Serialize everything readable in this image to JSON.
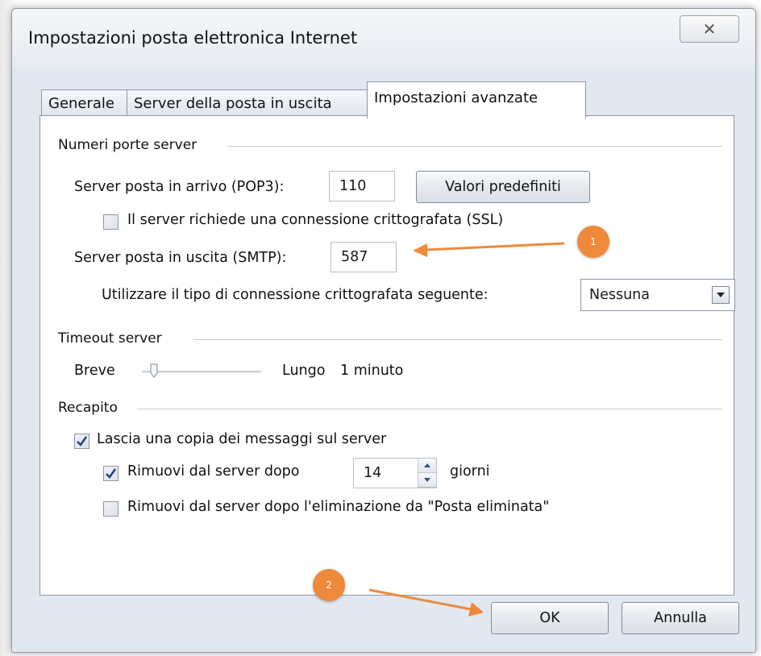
{
  "window": {
    "title": "Impostazioni posta elettronica Internet",
    "close_glyph": "✕"
  },
  "tabs": [
    {
      "label": "Generale"
    },
    {
      "label": "Server della posta in uscita"
    },
    {
      "label": "Impostazioni avanzate"
    }
  ],
  "ports": {
    "group_label": "Numeri porte server",
    "incoming_label": "Server posta in arrivo (POP3):",
    "incoming_value": "110",
    "defaults_button": "Valori predefiniti",
    "ssl_label": "Il server richiede una connessione crittografata (SSL)",
    "ssl_checked": false,
    "outgoing_label": "Server posta in uscita (SMTP):",
    "outgoing_value": "587",
    "encryption_label": "Utilizzare il tipo di connessione crittografata seguente:",
    "encryption_value": "Nessuna"
  },
  "timeout": {
    "group_label": "Timeout server",
    "short_label": "Breve",
    "long_label": "Lungo",
    "value_text": "1 minuto",
    "slider_level": 0.1
  },
  "delivery": {
    "group_label": "Recapito",
    "leave_copy_label": "Lascia una copia dei messaggi sul server",
    "leave_copy_checked": true,
    "remove_after_label": "Rimuovi dal server dopo",
    "remove_after_checked": true,
    "remove_after_days": "14",
    "days_label": "giorni",
    "remove_deleted_label": "Rimuovi dal server dopo l'eliminazione da \"Posta eliminata\"",
    "remove_deleted_checked": false
  },
  "footer": {
    "ok_label": "OK",
    "cancel_label": "Annulla"
  },
  "annotations": [
    {
      "label": "1"
    },
    {
      "label": "2"
    }
  ],
  "colors": {
    "annotation": "#ef8a3c",
    "window_bg": "#e2e8f0"
  }
}
